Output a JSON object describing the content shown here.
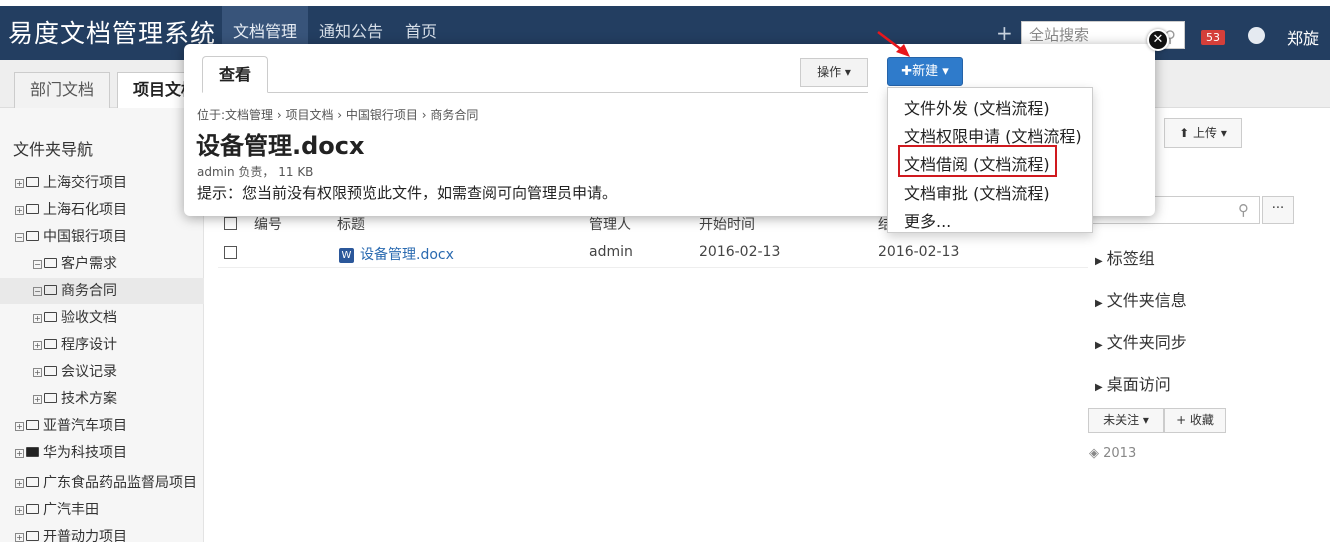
{
  "app": {
    "brand": "易度文档管理系统",
    "nav": [
      "文档管理",
      "通知公告",
      "首页"
    ],
    "plus": "+",
    "search_placeholder": "全站搜索",
    "badge": "53",
    "user": "郑旋"
  },
  "subtabs": [
    "部门文档",
    "项目文档"
  ],
  "sidebar": {
    "title": "文件夹导航",
    "items": [
      {
        "toggle": "+",
        "label": "上海交行项目"
      },
      {
        "toggle": "+",
        "label": "上海石化项目"
      },
      {
        "toggle": "−",
        "label": "中国银行项目"
      },
      {
        "toggle": "−",
        "label": "客户需求"
      },
      {
        "toggle": "−",
        "label": "商务合同"
      },
      {
        "toggle": "+",
        "label": "验收文档"
      },
      {
        "toggle": "+",
        "label": "程序设计"
      },
      {
        "toggle": "+",
        "label": "会议记录"
      },
      {
        "toggle": "+",
        "label": "技术方案"
      },
      {
        "toggle": "+",
        "label": "亚普汽车项目"
      },
      {
        "toggle": "+",
        "label": "华为科技项目"
      },
      {
        "toggle": "+",
        "label": "广东食品药品监督局项目"
      },
      {
        "toggle": "+",
        "label": "广汽丰田"
      },
      {
        "toggle": "+",
        "label": "开普动力项目"
      }
    ]
  },
  "table": {
    "headers": [
      "编号",
      "标题",
      "管理人",
      "开始时间",
      "结"
    ],
    "rows": [
      {
        "title": "设备管理.docx",
        "manager": "admin",
        "start": "2016-02-13",
        "end": "2016-02-13"
      }
    ]
  },
  "right_panel": {
    "upload": "上传",
    "more": "···",
    "links": [
      "标签组",
      "文件夹信息",
      "文件夹同步",
      "桌面访问"
    ],
    "follow": "未关注",
    "favorite": "+ 收藏",
    "tag": "2013"
  },
  "modal": {
    "tab": "查看",
    "ops": "操作",
    "breadcrumb": "位于:文档管理 › 项目文档 › 中国银行项目 › 商务合同",
    "doc_title": "设备管理.docx",
    "meta": "admin 负责， 11 KB",
    "hint": "提示：您当前没有权限预览此文件，如需查阅可向管理员申请。"
  },
  "new_menu": {
    "button": "新建",
    "items": [
      "文件外发 (文档流程)",
      "文档权限申请 (文档流程)",
      "文档借阅 (文档流程)",
      "文档审批 (文档流程)",
      "更多..."
    ]
  },
  "colors": {
    "nav_bg": "#233e61",
    "primary_button": "#2f7bcb",
    "highlight": "#d0191e"
  }
}
